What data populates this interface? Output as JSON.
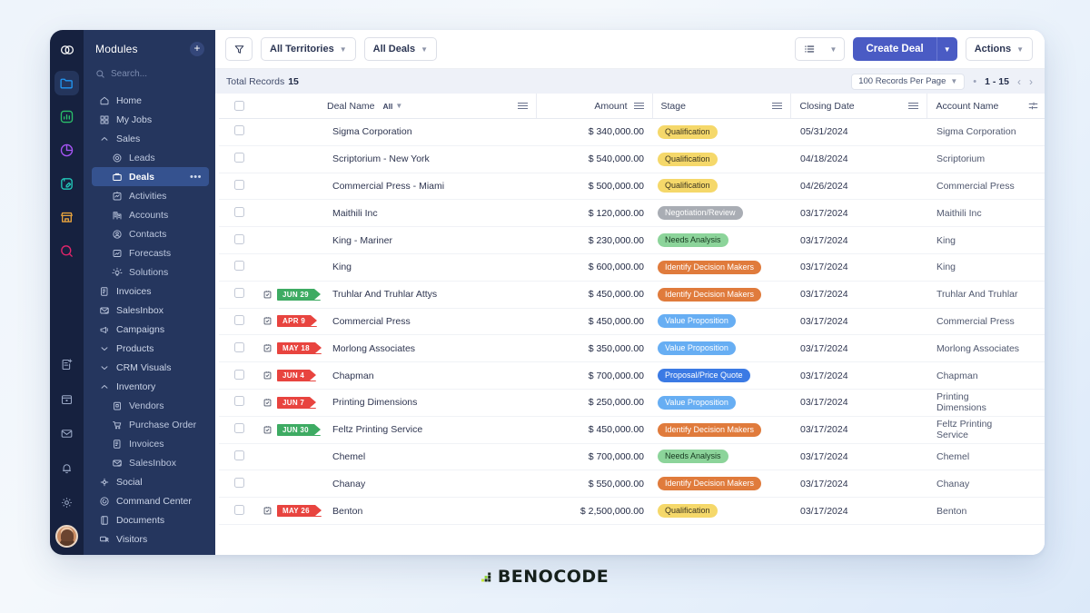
{
  "rail": {
    "items": [
      {
        "icon": "link-chain-logo-icon",
        "color": "#ffffff",
        "active": false
      },
      {
        "icon": "folder-icon",
        "color": "#2196f3",
        "active": true
      },
      {
        "icon": "bar-chart-icon",
        "color": "#2bbf6a"
      },
      {
        "icon": "pie-chart-icon",
        "color": "#a855f7"
      },
      {
        "icon": "notebook-pen-icon",
        "color": "#22c7b8"
      },
      {
        "icon": "store-icon",
        "color": "#e8a33d"
      },
      {
        "icon": "search-circle-icon",
        "color": "#e4246b"
      }
    ],
    "bottom_items": [
      {
        "icon": "new-document-icon"
      },
      {
        "icon": "calendar-icon"
      },
      {
        "icon": "mail-icon"
      },
      {
        "icon": "bell-icon"
      },
      {
        "icon": "gear-icon"
      },
      {
        "icon": "user-avatar"
      }
    ]
  },
  "sidebar": {
    "title": "Modules",
    "add_label": "+",
    "search_placeholder": "Search...",
    "items": [
      {
        "label": "Home",
        "icon": "home-icon",
        "level": 0
      },
      {
        "label": "My Jobs",
        "icon": "grid-icon",
        "level": 0
      },
      {
        "label": "Sales",
        "icon": "chevron-up-icon",
        "level": 0,
        "group": true
      },
      {
        "label": "Leads",
        "icon": "target-icon",
        "level": 1
      },
      {
        "label": "Deals",
        "icon": "briefcase-icon",
        "level": 1,
        "selected": true,
        "more": "•••"
      },
      {
        "label": "Activities",
        "icon": "activity-icon",
        "level": 1
      },
      {
        "label": "Accounts",
        "icon": "building-icon",
        "level": 1
      },
      {
        "label": "Contacts",
        "icon": "contact-icon",
        "level": 1
      },
      {
        "label": "Forecasts",
        "icon": "forecast-icon",
        "level": 1
      },
      {
        "label": "Solutions",
        "icon": "lightbulb-icon",
        "level": 1
      },
      {
        "label": "Invoices",
        "icon": "invoice-icon",
        "level": 0
      },
      {
        "label": "SalesInbox",
        "icon": "inbox-mail-icon",
        "level": 0
      },
      {
        "label": "Campaigns",
        "icon": "megaphone-icon",
        "level": 0
      },
      {
        "label": "Products",
        "icon": "chevron-down-icon",
        "level": 0,
        "group": true
      },
      {
        "label": "CRM Visuals",
        "icon": "chevron-down-icon",
        "level": 0,
        "group": true
      },
      {
        "label": "Inventory",
        "icon": "chevron-up-icon",
        "level": 0,
        "group": true
      },
      {
        "label": "Vendors",
        "icon": "vendor-icon",
        "level": 1
      },
      {
        "label": "Purchase Order",
        "icon": "cart-icon",
        "level": 1
      },
      {
        "label": "Invoices",
        "icon": "invoice-icon",
        "level": 1
      },
      {
        "label": "SalesInbox",
        "icon": "inbox-mail-icon",
        "level": 1
      },
      {
        "label": "Social",
        "icon": "social-icon",
        "level": 0
      },
      {
        "label": "Command Center",
        "icon": "command-center-icon",
        "level": 0
      },
      {
        "label": "Documents",
        "icon": "documents-icon",
        "level": 0
      },
      {
        "label": "Visitors",
        "icon": "visitors-icon",
        "level": 0
      }
    ]
  },
  "toolbar": {
    "filter_icon": "funnel-icon",
    "territories_label": "All Territories",
    "deals_filter_label": "All Deals",
    "view_icon": "list-view-icon",
    "create_deal_label": "Create Deal",
    "actions_label": "Actions"
  },
  "records_bar": {
    "total_label": "Total Records",
    "total_count": "15",
    "per_page_label": "100 Records Per Page",
    "separator": "•",
    "range_label": "1 - 15",
    "prev_icon": "chevron-left-icon",
    "next_icon": "chevron-right-icon"
  },
  "table": {
    "columns": [
      {
        "key": "checkbox",
        "label": ""
      },
      {
        "key": "flag",
        "label": ""
      },
      {
        "key": "deal_name",
        "label": "Deal Name",
        "filter": "All"
      },
      {
        "key": "amount",
        "label": "Amount"
      },
      {
        "key": "stage",
        "label": "Stage"
      },
      {
        "key": "closing_date",
        "label": "Closing Date"
      },
      {
        "key": "account_name",
        "label": "Account Name"
      },
      {
        "key": "settings",
        "label": "",
        "icon": "column-settings-icon"
      }
    ],
    "rows": [
      {
        "flag": null,
        "deal_name": "Sigma Corporation",
        "amount": "$ 340,000.00",
        "stage": "Qualification",
        "stage_color": "yellow",
        "closing_date": "05/31/2024",
        "account_name": "Sigma Corporation"
      },
      {
        "flag": null,
        "deal_name": "Scriptorium - New York",
        "amount": "$ 540,000.00",
        "stage": "Qualification",
        "stage_color": "yellow",
        "closing_date": "04/18/2024",
        "account_name": "Scriptorium"
      },
      {
        "flag": null,
        "deal_name": "Commercial Press - Miami",
        "amount": "$ 500,000.00",
        "stage": "Qualification",
        "stage_color": "yellow",
        "closing_date": "04/26/2024",
        "account_name": "Commercial Press"
      },
      {
        "flag": null,
        "deal_name": "Maithili Inc",
        "amount": "$ 120,000.00",
        "stage": "Negotiation/Review",
        "stage_color": "grey",
        "closing_date": "03/17/2024",
        "account_name": "Maithili Inc"
      },
      {
        "flag": null,
        "deal_name": "King - Mariner",
        "amount": "$ 230,000.00",
        "stage": "Needs Analysis",
        "stage_color": "green",
        "closing_date": "03/17/2024",
        "account_name": "King"
      },
      {
        "flag": null,
        "deal_name": "King",
        "amount": "$ 600,000.00",
        "stage": "Identify Decision Makers",
        "stage_color": "orange",
        "closing_date": "03/17/2024",
        "account_name": "King"
      },
      {
        "flag": {
          "label": "JUN 29",
          "color": "green"
        },
        "deal_name": "Truhlar And Truhlar Attys",
        "amount": "$ 450,000.00",
        "stage": "Identify Decision Makers",
        "stage_color": "orange",
        "closing_date": "03/17/2024",
        "account_name": "Truhlar And Truhlar"
      },
      {
        "flag": {
          "label": "APR 9",
          "color": "red"
        },
        "deal_name": "Commercial Press",
        "amount": "$ 450,000.00",
        "stage": "Value Proposition",
        "stage_color": "lblue",
        "closing_date": "03/17/2024",
        "account_name": "Commercial Press"
      },
      {
        "flag": {
          "label": "MAY 18",
          "color": "red"
        },
        "deal_name": "Morlong Associates",
        "amount": "$ 350,000.00",
        "stage": "Value Proposition",
        "stage_color": "lblue",
        "closing_date": "03/17/2024",
        "account_name": "Morlong Associates"
      },
      {
        "flag": {
          "label": "JUN 4",
          "color": "red"
        },
        "deal_name": "Chapman",
        "amount": "$ 700,000.00",
        "stage": "Proposal/Price Quote",
        "stage_color": "blue",
        "closing_date": "03/17/2024",
        "account_name": "Chapman"
      },
      {
        "flag": {
          "label": "JUN 7",
          "color": "red"
        },
        "deal_name": "Printing Dimensions",
        "amount": "$ 250,000.00",
        "stage": "Value Proposition",
        "stage_color": "lblue",
        "closing_date": "03/17/2024",
        "account_name": "Printing Dimensions"
      },
      {
        "flag": {
          "label": "JUN 30",
          "color": "green"
        },
        "deal_name": "Feltz Printing Service",
        "amount": "$ 450,000.00",
        "stage": "Identify Decision Makers",
        "stage_color": "orange",
        "closing_date": "03/17/2024",
        "account_name": "Feltz Printing Service"
      },
      {
        "flag": null,
        "deal_name": "Chemel",
        "amount": "$ 700,000.00",
        "stage": "Needs Analysis",
        "stage_color": "green",
        "closing_date": "03/17/2024",
        "account_name": "Chemel"
      },
      {
        "flag": null,
        "deal_name": "Chanay",
        "amount": "$ 550,000.00",
        "stage": "Identify Decision Makers",
        "stage_color": "orange",
        "closing_date": "03/17/2024",
        "account_name": "Chanay"
      },
      {
        "flag": {
          "label": "MAY 26",
          "color": "red"
        },
        "deal_name": "Benton",
        "amount": "$ 2,500,000.00",
        "stage": "Qualification",
        "stage_color": "yellow",
        "closing_date": "03/17/2024",
        "account_name": "Benton"
      }
    ]
  },
  "footer": {
    "brand": "BENOCODE"
  },
  "colors": {
    "accent": "#4a5bc4",
    "sidebar": "#25365e",
    "rail": "#16213f",
    "flag_green": "#3eab63",
    "flag_red": "#e8443f"
  }
}
